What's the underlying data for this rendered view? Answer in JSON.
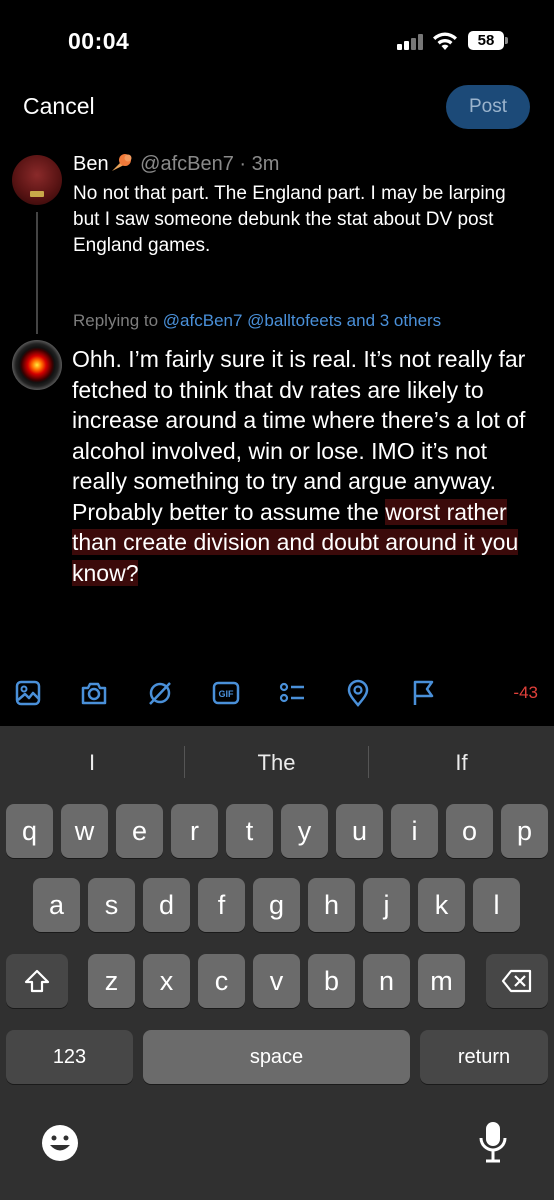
{
  "status_bar": {
    "time": "00:04",
    "battery": "58"
  },
  "header": {
    "cancel_label": "Cancel",
    "post_label": "Post"
  },
  "original_tweet": {
    "name": "Ben",
    "handle": "@afcBen7",
    "separator": "·",
    "age": "3m",
    "text": "No not that part. The England part. I may be larping but I saw someone debunk the stat about DV post England games."
  },
  "replying": {
    "prefix": "Replying to",
    "mentions": [
      "@afcBen7",
      "@balltofeets"
    ],
    "others": "and 3 others"
  },
  "reply": {
    "text_plain": "Ohh. I’m fairly sure it is real. It’s not really far fetched to think that dv rates are likely to increase around a time where there’s a lot of alcohol involved, win or lose. IMO it’s not really something to try and argue anyway. Probably better to assume the ",
    "text_highlighted": "worst rather than create division and doubt around it you know?"
  },
  "toolbar": {
    "icons": [
      "image-icon",
      "camera-icon",
      "gif-icon",
      "poll-icon",
      "location-icon",
      "flag-icon"
    ],
    "gif_label": "GIF",
    "char_count": "-43"
  },
  "keyboard": {
    "suggestions": [
      "I",
      "The",
      "If"
    ],
    "row1": [
      "q",
      "w",
      "e",
      "r",
      "t",
      "y",
      "u",
      "i",
      "o",
      "p"
    ],
    "row2": [
      "a",
      "s",
      "d",
      "f",
      "g",
      "h",
      "j",
      "k",
      "l"
    ],
    "row3": [
      "z",
      "x",
      "c",
      "v",
      "b",
      "n",
      "m"
    ],
    "numbers_label": "123",
    "space_label": "space",
    "return_label": "return"
  },
  "colors": {
    "accent_blue": "#4a90d9",
    "post_button_bg": "#1c4a78",
    "counter_red": "#e0403a",
    "highlight_bg": "#3b0a0a",
    "keyboard_bg": "#303030",
    "key_bg": "#6b6b6b"
  }
}
